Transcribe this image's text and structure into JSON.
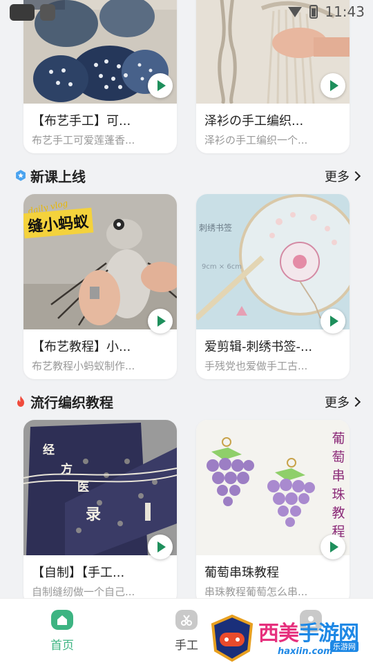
{
  "status_bar": {
    "time": "11:43"
  },
  "sections": [
    {
      "title": "",
      "cards": [
        {
          "title": "【布艺手工】可...",
          "subtitle": "布艺手工可爱莲蓬香..."
        },
        {
          "title": "泽衫の手工编织...",
          "subtitle": "泽衫の手工编织一个..."
        }
      ]
    },
    {
      "title": "新课上线",
      "more": "更多",
      "cards": [
        {
          "title": "【布艺教程】小...",
          "subtitle": "布艺教程小蚂蚁制作...",
          "image_text": "缝小蚂蚁",
          "image_tag": "daily vlog"
        },
        {
          "title": "爱剪辑-刺绣书签-...",
          "subtitle": "手残党也爱做手工古...",
          "image_text": "刺绣书签",
          "image_sub": "9cm × 6cm"
        }
      ]
    },
    {
      "title": "流行编织教程",
      "more": "更多",
      "cards": [
        {
          "title": "【自制】【手工...",
          "subtitle": "自制缝纫做一个自己...",
          "image_text": [
            "经",
            "方",
            "医",
            "录"
          ]
        },
        {
          "title": "葡萄串珠教程",
          "subtitle": "串珠教程葡萄怎么串...",
          "image_text": [
            "葡",
            "萄",
            "串",
            "珠",
            "教",
            "程"
          ]
        }
      ]
    }
  ],
  "tabbar": {
    "tabs": [
      {
        "label": "首页",
        "icon": "home-icon",
        "active": true
      },
      {
        "label": "手工",
        "icon": "scissors-icon",
        "active": false
      },
      {
        "label": "",
        "icon": "profile-icon",
        "active": false
      }
    ]
  },
  "watermark": {
    "text_a": "西美",
    "text_b": "手游网",
    "url": "haxiin.com",
    "badge": "乐游网"
  },
  "colors": {
    "accent": "#1e8f5c",
    "section_icon_blue": "#4aa3ef",
    "section_icon_fire": "#f04b3c",
    "tab_active": "#3db482",
    "tab_inactive": "#444444"
  }
}
